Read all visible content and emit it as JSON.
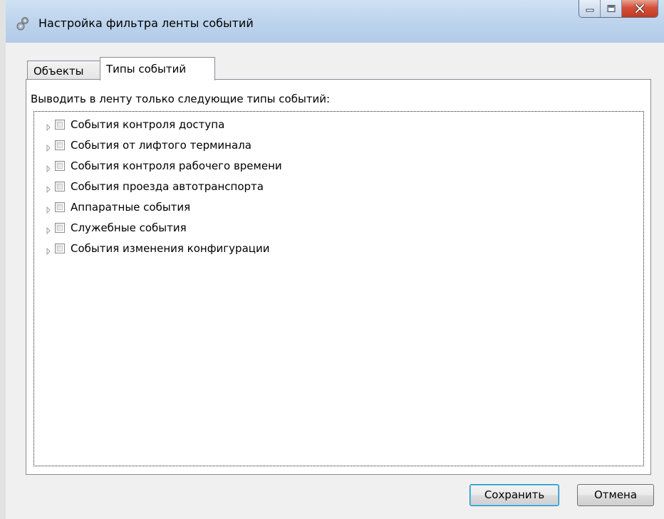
{
  "window": {
    "title": "Настройка фильтра ленты событий"
  },
  "tabs": [
    {
      "label": "Объекты",
      "selected": false
    },
    {
      "label": "Типы событий",
      "selected": true
    }
  ],
  "panel": {
    "caption": "Выводить в ленту только следующие типы событий:"
  },
  "event_types": [
    {
      "label": "События контроля доступа",
      "checked": false
    },
    {
      "label": "События от лифтого терминала",
      "checked": false
    },
    {
      "label": "События контроля рабочего времени",
      "checked": false
    },
    {
      "label": "События проезда автотранспорта",
      "checked": false
    },
    {
      "label": "Аппаратные события",
      "checked": false
    },
    {
      "label": "Служебные события",
      "checked": false
    },
    {
      "label": "События изменения конфигурации",
      "checked": false
    }
  ],
  "buttons": {
    "save_label": "Сохранить",
    "cancel_label": "Отмена"
  },
  "colors": {
    "titlebar": "#bcd3ec",
    "close_button": "#c8452c",
    "default_button_border": "#3c7fb1"
  }
}
